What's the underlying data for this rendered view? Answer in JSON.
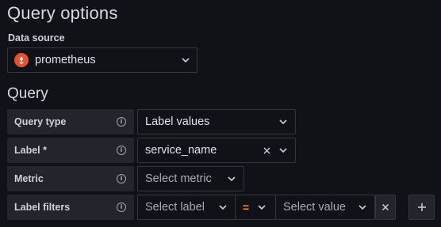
{
  "page": {
    "title": "Query options"
  },
  "datasource": {
    "label": "Data source",
    "name": "prometheus",
    "icon": "prometheus-logo",
    "brand_color": "#e6522c"
  },
  "query": {
    "section_title": "Query",
    "rows": {
      "query_type": {
        "label": "Query type",
        "value": "Label values"
      },
      "label": {
        "label": "Label *",
        "value": "service_name"
      },
      "metric": {
        "label": "Metric",
        "placeholder": "Select metric"
      },
      "label_filters": {
        "label": "Label filters",
        "label_placeholder": "Select label",
        "operator": "=",
        "value_placeholder": "Select value"
      }
    }
  },
  "colors": {
    "background": "#111217",
    "label_bg": "#22252b",
    "border": "#34363e",
    "operator": "#ff9830"
  }
}
